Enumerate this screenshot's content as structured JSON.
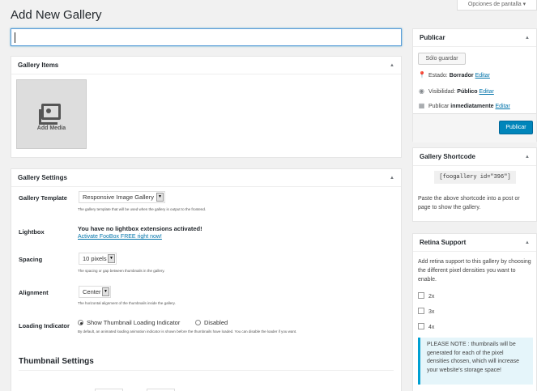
{
  "screen_options": "Opciones de pantalla",
  "page_title": "Add New Gallery",
  "title_input": {
    "value": "",
    "placeholder": ""
  },
  "gallery_items": {
    "title": "Gallery Items",
    "add_media": "Add Media"
  },
  "gallery_settings": {
    "title": "Gallery Settings",
    "template": {
      "label": "Gallery Template",
      "value": "Responsive Image Gallery",
      "help": "The gallery template that will be used when the gallery is output to the frontend."
    },
    "lightbox": {
      "label": "Lightbox",
      "message": "You have no lightbox extensions activated!",
      "link": "Activate FooBox FREE right now!"
    },
    "spacing": {
      "label": "Spacing",
      "value": "10 pixels",
      "help": "The spacing or gap between thumbnails in the gallery."
    },
    "alignment": {
      "label": "Alignment",
      "value": "Center",
      "help": "The horizontal alignment of the thumbnails inside the gallery."
    },
    "loading": {
      "label": "Loading Indicator",
      "option1": "Show Thumbnail Loading Indicator",
      "option2": "Disabled",
      "selected": "option1",
      "help": "By default, an animated loading animation indicator is shown before the thumbnails have loaded. You can disable the loader if you want."
    },
    "thumbnail_title": "Thumbnail Settings"
  },
  "publish": {
    "title": "Publicar",
    "save_draft": "Sólo guardar",
    "status_label": "Estado:",
    "status_value": "Borrador",
    "visibility_label": "Visibilidad:",
    "visibility_value": "Público",
    "schedule_label": "Publicar",
    "schedule_value": "inmediatamente",
    "edit": "Editar",
    "publish_button": "Publicar"
  },
  "shortcode": {
    "title": "Gallery Shortcode",
    "code": "[foogallery id=\"396\"]",
    "help": "Paste the above shortcode into a post or page to show the gallery."
  },
  "retina": {
    "title": "Retina Support",
    "desc": "Add retina support to this gallery by choosing the different pixel densities you want to enable.",
    "options": [
      "2x",
      "3x",
      "4x"
    ],
    "note": "PLEASE NOTE : thumbnails will be generated for each of the pixel densities chosen, which will increase your website's storage space!"
  },
  "colors": {
    "accent": "#0085ba",
    "link": "#0073aa",
    "note_bg": "#e5f5fa"
  },
  "icons": {
    "status": "pin-icon",
    "visibility": "eye-icon",
    "schedule": "calendar-icon",
    "add_media": "media-icon"
  }
}
